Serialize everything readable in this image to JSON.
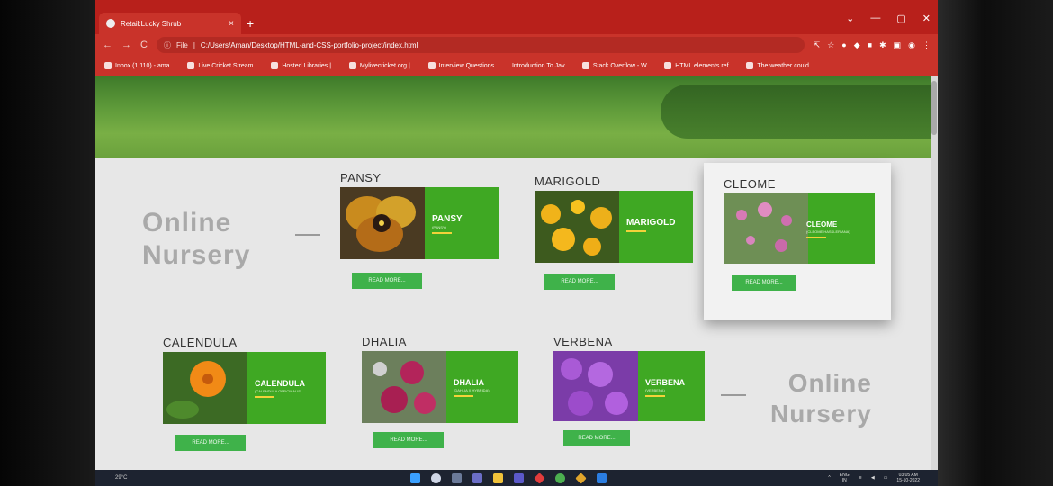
{
  "browser": {
    "tab_title": "Retail:Lucky Shrub",
    "tab_close": "×",
    "new_tab": "+",
    "window_controls": [
      "⌄",
      "—",
      "▢",
      "✕"
    ],
    "nav": {
      "back": "←",
      "forward": "→",
      "reload": "C"
    },
    "address_prefix": "File",
    "url": "C:/Users/Aman/Desktop/HTML-and-CSS-portfolio-project/index.html",
    "bookmarks": [
      "Inbox (1,110) - ama...",
      "Live Cricket Stream...",
      "Hosted Libraries |...",
      "Mylivecricket.org |...",
      "Interview Questions...",
      "Introduction To Jav...",
      "Stack Overflow - W...",
      "HTML elements ref...",
      "The weather could..."
    ]
  },
  "page": {
    "nursery_line1": "Online",
    "nursery_line2": "Nursery",
    "cards": [
      {
        "title": "PANSY",
        "name": "PANSY",
        "sci": "(PANSY)",
        "button": "READ MORE..."
      },
      {
        "title": "MARIGOLD",
        "name": "MARIGOLD",
        "sci": "",
        "button": "READ MORE..."
      },
      {
        "title": "CLEOME",
        "name": "CLEOME",
        "sci": "(CLEOME HASSLERIANA)",
        "button": "READ MORE..."
      },
      {
        "title": "CALENDULA",
        "name": "CALENDULA",
        "sci": "(CALENDULA OFFICINALIS)",
        "button": "READ MORE..."
      },
      {
        "title": "DHALIA",
        "name": "DHALIA",
        "sci": "(DAHLIA X HYBRIDA)",
        "button": "READ MORE..."
      },
      {
        "title": "VERBENA",
        "name": "VERBENA",
        "sci": "(VERBENA)",
        "button": "READ MORE..."
      }
    ]
  },
  "taskbar": {
    "weather": "29°C",
    "lang": "ENG",
    "region": "IN",
    "time": "03:05 AM",
    "date": "15-10-2022"
  },
  "colors": {
    "chrome_red": "#c9332a",
    "banner_green": "#3fa823",
    "button_green": "#3fb24a",
    "nursery_grey": "#a9a9a9"
  }
}
